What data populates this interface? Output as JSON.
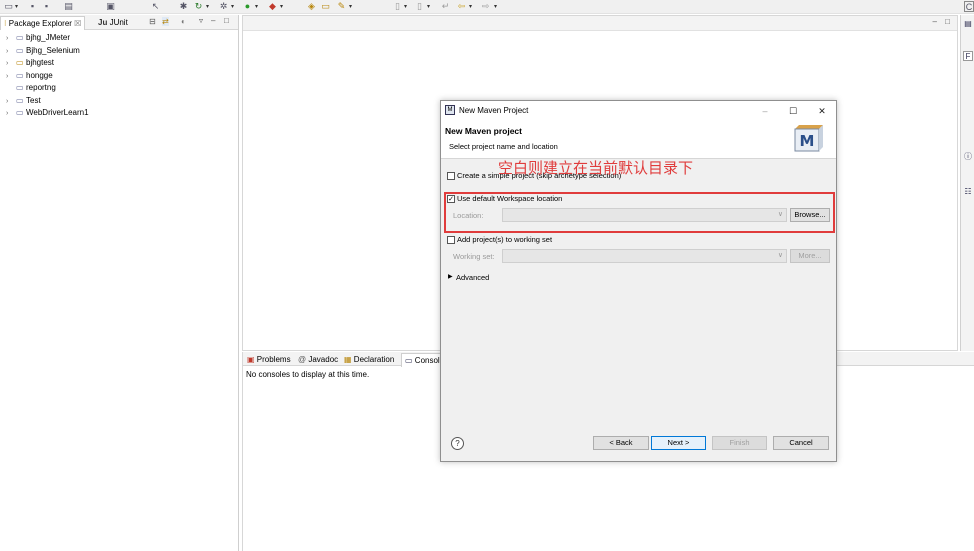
{
  "explorer": {
    "tabs": [
      {
        "label": "Package Explorer",
        "close": "☒"
      },
      {
        "label": "JUnit"
      }
    ],
    "projects": [
      {
        "label": "bjhg_JMeter",
        "expandable": true
      },
      {
        "label": "Bjhg_Selenium",
        "expandable": true
      },
      {
        "label": "bjhgtest",
        "expandable": true
      },
      {
        "label": "hongge",
        "expandable": true
      },
      {
        "label": "reportng",
        "expandable": false
      },
      {
        "label": "Test",
        "expandable": true
      },
      {
        "label": "WebDriverLearn1",
        "expandable": true
      }
    ]
  },
  "bottom_panel": {
    "tabs": [
      "Problems",
      "Javadoc",
      "Declaration",
      "Console"
    ],
    "message": "No consoles to display at this time."
  },
  "dialog": {
    "window_title": "New Maven Project",
    "header_title": "New Maven project",
    "header_subtitle": "Select project name and location",
    "simple_project_label": "Create a simple project (skip archetype selection)",
    "simple_project_checked": false,
    "use_default_label": "Use default Workspace location",
    "use_default_checked": true,
    "location_label": "Location:",
    "location_value": "",
    "browse_label": "Browse...",
    "working_set_label": "Add project(s) to working set",
    "working_set_checked": false,
    "working_set_field_label": "Working set:",
    "more_label": "More...",
    "advanced_label": "Advanced",
    "back_label": "< Back",
    "next_label": "Next >",
    "finish_label": "Finish",
    "cancel_label": "Cancel",
    "annotation": "空白则建立在当前默认目录下"
  },
  "colors": {
    "annotation": "#e03c3c",
    "focus": "#0078d7"
  }
}
